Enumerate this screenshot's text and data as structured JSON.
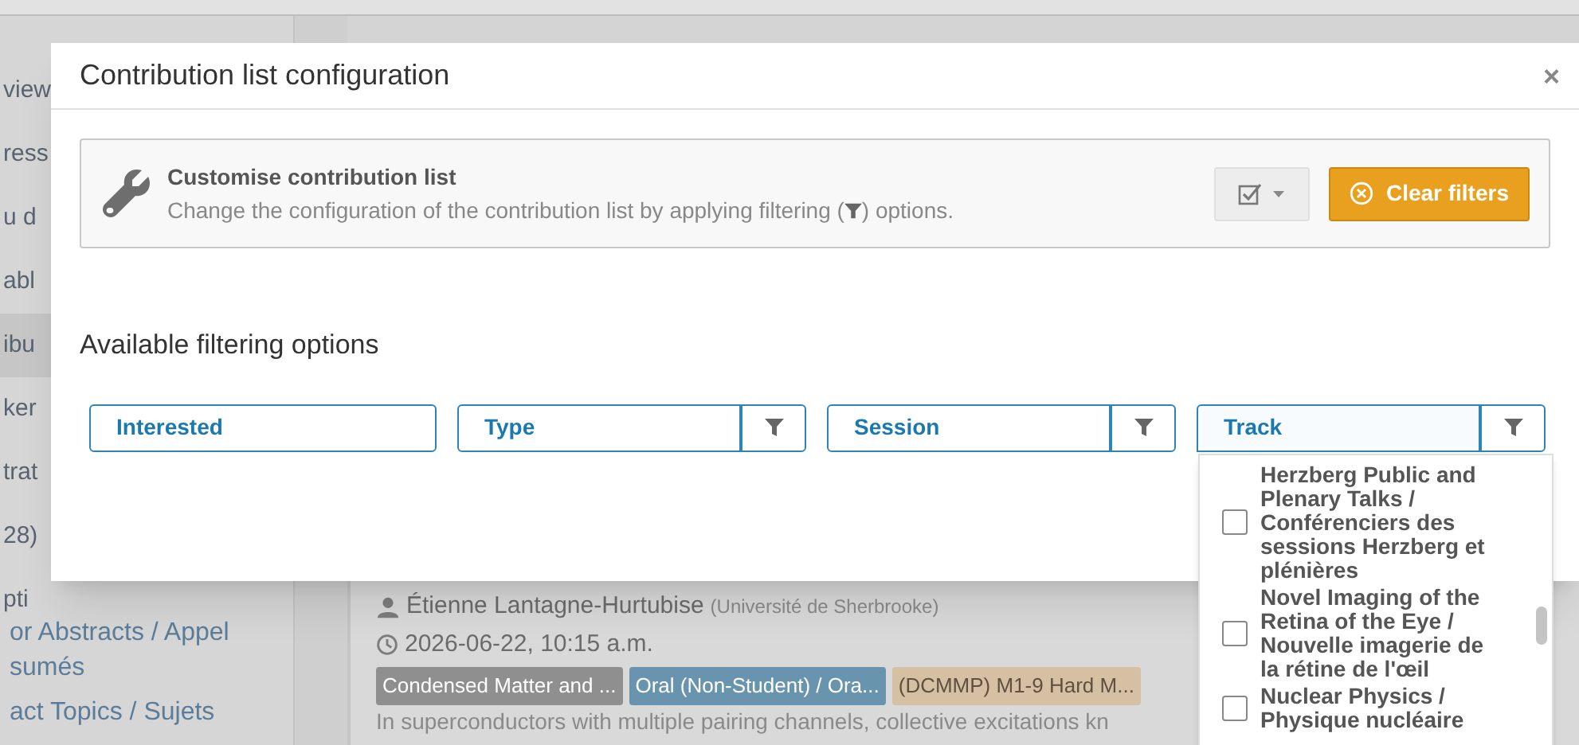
{
  "sidebar": {
    "top_items": [
      {
        "label": "view",
        "selected": false
      },
      {
        "label": "ress",
        "selected": false
      },
      {
        "label": "u d",
        "selected": false
      },
      {
        "label": "abl",
        "selected": false
      },
      {
        "label": "ibu",
        "selected": true
      },
      {
        "label": "ker",
        "selected": false
      },
      {
        "label": "trat",
        "selected": false
      },
      {
        "label": "28)",
        "selected": false
      },
      {
        "label": "pti",
        "selected": false
      }
    ],
    "bottom_items": [
      {
        "label": "or Abstracts / Appel sumés"
      },
      {
        "label": "act Topics / Sujets"
      }
    ]
  },
  "contribution": {
    "speaker": "Étienne Lantagne-Hurtubise",
    "affiliation": "(Université de Sherbrooke)",
    "time": "2026-06-22, 10:15 a.m.",
    "tags": [
      {
        "label": "Condensed Matter and ...",
        "color": "#8f8f8f"
      },
      {
        "label": "Oral (Non-Student) / Ora...",
        "color": "#6894ad"
      },
      {
        "label": "(DCMMP) M1-9 Hard M...",
        "color": "#d6c0a4"
      }
    ],
    "abstract": "In superconductors with multiple pairing channels, collective excitations kn"
  },
  "modal": {
    "title": "Contribution list configuration",
    "close": "×",
    "info": {
      "title": "Customise contribution list",
      "text_start": "Change the configuration of the contribution list by applying filtering (",
      "text_end": ") options."
    },
    "clear_button": "Clear filters",
    "heading": "Available filtering options",
    "filters": [
      {
        "label": "Interested",
        "has_filter_button": false,
        "expanded": false
      },
      {
        "label": "Type",
        "has_filter_button": true,
        "expanded": false
      },
      {
        "label": "Session",
        "has_filter_button": true,
        "expanded": false
      },
      {
        "label": "Track",
        "has_filter_button": true,
        "expanded": true
      }
    ],
    "track_options": [
      {
        "label": "Herzberg Public and Plenary Talks / Conférenciers des sessions Herzberg et plénières",
        "checked": false
      },
      {
        "label": "Novel Imaging of the Retina of the Eye / Nouvelle imagerie de la rétine de l'œil",
        "checked": false
      },
      {
        "label": "Nuclear Physics / Physique nucléaire",
        "checked": false
      }
    ]
  }
}
